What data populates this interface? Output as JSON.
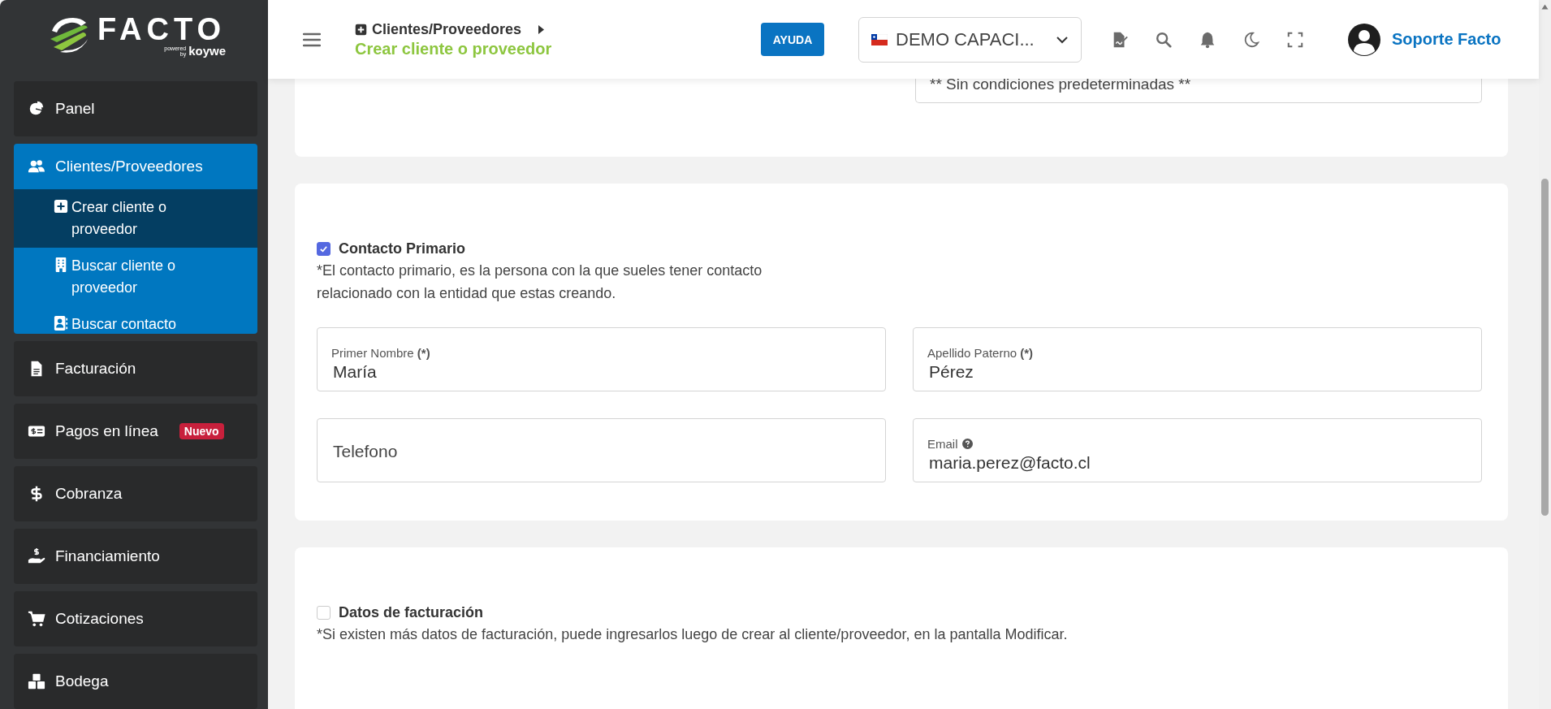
{
  "logo": {
    "name": "FACTO",
    "powered": "powered",
    "by": "by",
    "brand": "koywe"
  },
  "sidebar": {
    "items": [
      {
        "label": "Panel",
        "selected": false,
        "expanded": false
      },
      {
        "label": "Clientes/Proveedores",
        "selected": true,
        "expanded": true,
        "children": [
          {
            "label": "Crear cliente o proveedor",
            "selected": true
          },
          {
            "label": "Buscar cliente o proveedor",
            "selected": false
          },
          {
            "label": "Buscar contacto",
            "selected": false
          }
        ]
      },
      {
        "label": "Facturación",
        "selected": false,
        "expanded": false
      },
      {
        "label": "Pagos en línea",
        "badge": "Nuevo",
        "selected": false,
        "expanded": false
      },
      {
        "label": "Cobranza",
        "selected": false,
        "expanded": false
      },
      {
        "label": "Financiamiento",
        "selected": false,
        "expanded": false
      },
      {
        "label": "Cotizaciones",
        "selected": false,
        "expanded": false
      },
      {
        "label": "Bodega",
        "selected": false,
        "expanded": false
      }
    ]
  },
  "header": {
    "breadcrumb": {
      "parent": "Clientes/Proveedores",
      "current": "Crear cliente o proveedor"
    },
    "help_button": "AYUDA",
    "company_select": {
      "value": "DEMO CAPACI..."
    },
    "user": {
      "name": "Soporte Facto"
    }
  },
  "conditions_card": {
    "select": {
      "value": "** Sin condiciones predeterminadas **"
    }
  },
  "contact_card": {
    "title": "Contacto Primario",
    "checked": true,
    "note": "*El contacto primario, es la persona con la que sueles tener contacto relacionado con la entidad que estas creando.",
    "fields": [
      {
        "label": "Primer Nombre **(*)**",
        "value": "María",
        "help": false
      },
      {
        "label": "Apellido Paterno **(*)**",
        "value": "Pérez",
        "help": false
      },
      {
        "placeholder": "Telefono",
        "help": false
      },
      {
        "label": "Email",
        "value": "maria.perez@facto.cl",
        "help": true
      }
    ]
  },
  "billing_card": {
    "title": "Datos de facturación",
    "checked": false,
    "note": "*Si existen más datos de facturación, puede ingresarlos luego de crear al cliente/proveedor, en la pantalla Modificar."
  }
}
